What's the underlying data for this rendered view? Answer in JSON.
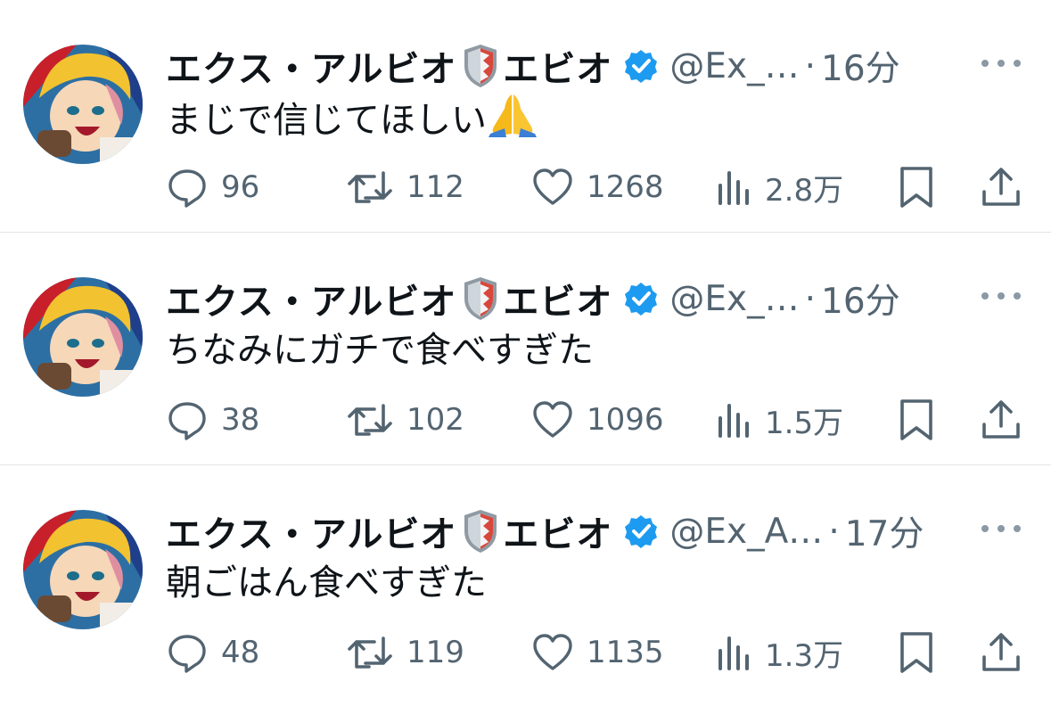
{
  "tweets": [
    {
      "author_name": "エクス・アルビオ",
      "author_name_suffix": "エビオ",
      "handle": "@Ex_…",
      "separator": "·",
      "time": "16分",
      "text": "まじで信じてほしい",
      "text_emoji": "folded-hands-emoji",
      "replies": "96",
      "retweets": "112",
      "likes": "1268",
      "views": "2.8万"
    },
    {
      "author_name": "エクス・アルビオ",
      "author_name_suffix": "エビオ",
      "handle": "@Ex_…",
      "separator": "·",
      "time": "16分",
      "text": "ちなみにガチで食べすぎた",
      "replies": "38",
      "retweets": "102",
      "likes": "1096",
      "views": "1.5万"
    },
    {
      "author_name": "エクス・アルビオ",
      "author_name_suffix": "エビオ",
      "handle": "@Ex_A…",
      "separator": "·",
      "time": "17分",
      "text": "朝ごはん食べすぎた",
      "replies": "48",
      "retweets": "119",
      "likes": "1135",
      "views": "1.3万"
    }
  ],
  "colors": {
    "verified": "#1d9bf0",
    "secondary_text": "#536471",
    "divider": "#e1e5e8"
  },
  "icons": [
    "reply-icon",
    "retweet-icon",
    "like-icon",
    "views-icon",
    "bookmark-icon",
    "share-icon",
    "more-icon",
    "verified-badge-icon",
    "shield-emoji-icon"
  ]
}
